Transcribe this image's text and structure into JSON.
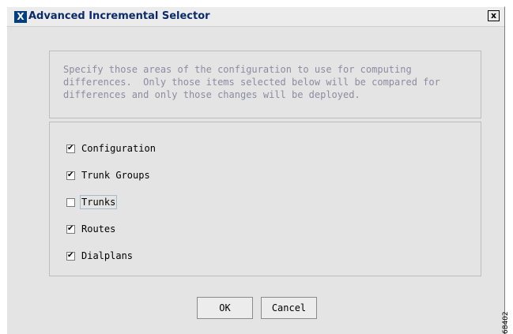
{
  "window": {
    "title": "Advanced Incremental Selector",
    "icon_letter": "X",
    "close_label": "x"
  },
  "description": {
    "text": "Specify those areas of the configuration to use for computing\ndifferences.  Only those items selected below will be compared for\ndifferences and only those changes will be deployed."
  },
  "options": [
    {
      "label": "Configuration",
      "checked": true
    },
    {
      "label": "Trunk Groups",
      "checked": true
    },
    {
      "label": "Trunks",
      "checked": false
    },
    {
      "label": "Routes",
      "checked": true
    },
    {
      "label": "Dialplans",
      "checked": true
    }
  ],
  "buttons": {
    "ok_label": "OK",
    "cancel_label": "Cancel"
  },
  "figure_number": "68402"
}
